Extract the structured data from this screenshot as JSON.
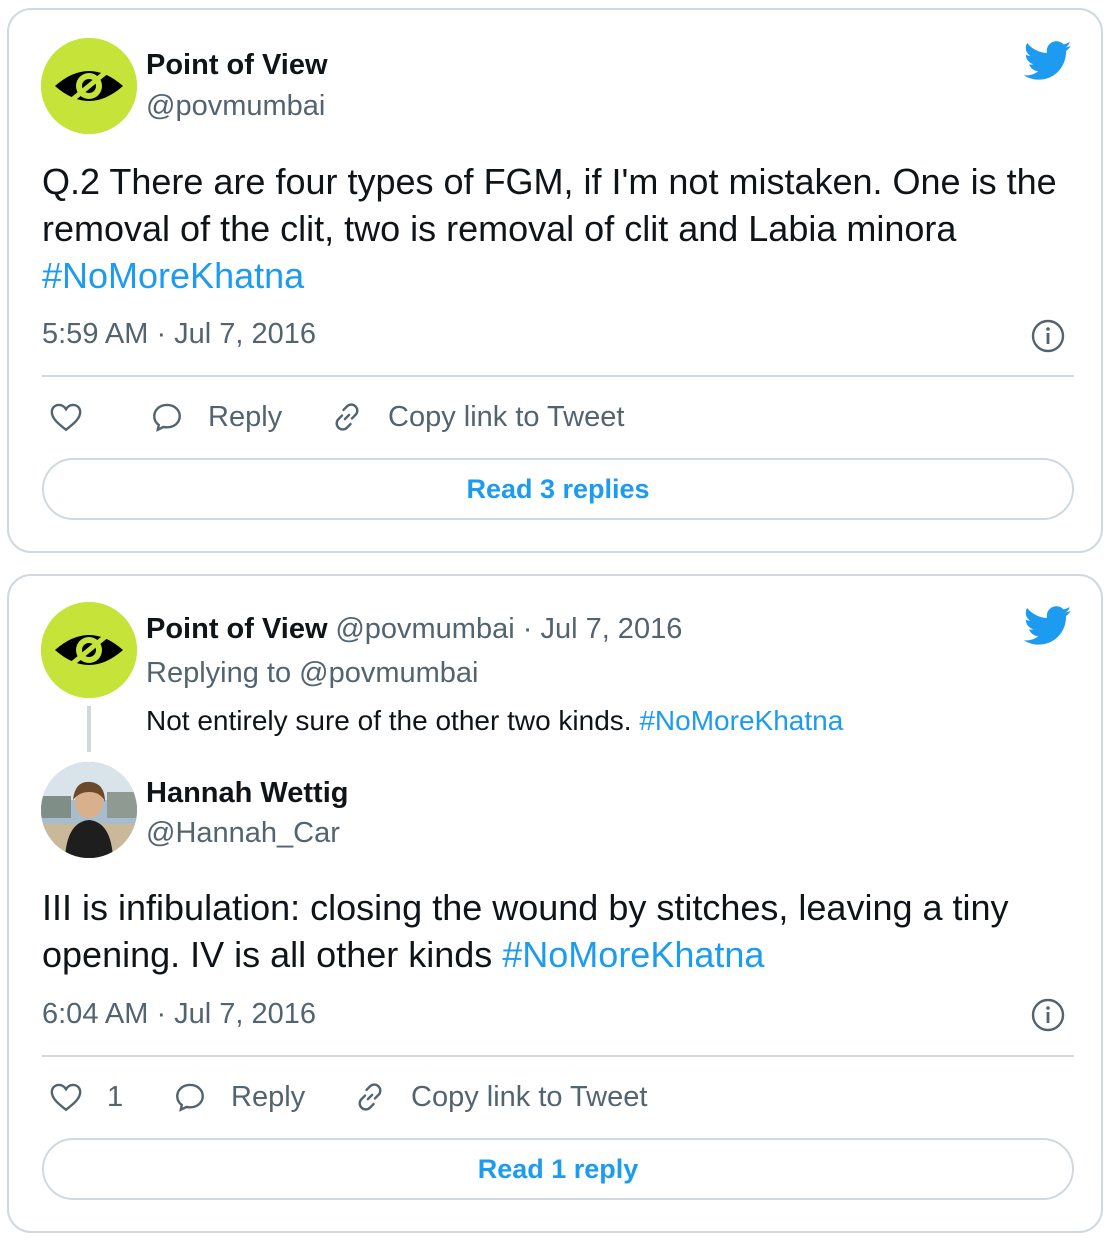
{
  "brand": {
    "accent": "#1d9bf0",
    "avatar_color": "#c6e33a"
  },
  "tweet1": {
    "author": {
      "name": "Point of View",
      "handle": "@povmumbai",
      "avatar_icon": "eye-logo-icon"
    },
    "text": "Q.2 There are four types of FGM, if I'm not mistaken. One is the removal of the clit, two is removal of clit and Labia minora ",
    "hashtag": "#NoMoreKhatna",
    "timestamp": "5:59 AM · Jul 7, 2016",
    "like_count": "",
    "actions": {
      "reply": "Reply",
      "copy_link": "Copy link to Tweet"
    },
    "read_replies": "Read 3 replies"
  },
  "tweet2": {
    "parent": {
      "name": "Point of View",
      "handle_date": "@povmumbai · Jul 7, 2016",
      "replying_to": "Replying to @povmumbai",
      "text": "Not entirely sure of the other two kinds. ",
      "hashtag": "#NoMoreKhatna"
    },
    "author": {
      "name": "Hannah Wettig",
      "handle": "@Hannah_Car"
    },
    "text": "III is infibulation: closing the wound by stitches, leaving a tiny opening. IV is all other kinds ",
    "hashtag": "#NoMoreKhatna",
    "timestamp": "6:04 AM · Jul 7, 2016",
    "like_count": "1",
    "actions": {
      "reply": "Reply",
      "copy_link": "Copy link to Tweet"
    },
    "read_replies": "Read 1 reply"
  }
}
